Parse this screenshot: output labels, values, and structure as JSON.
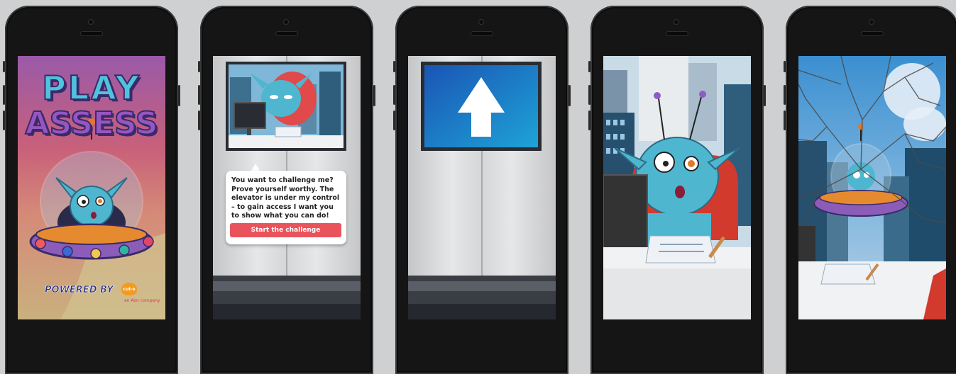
{
  "screens": [
    {
      "id": "title",
      "title_line1": "PLAY",
      "title_line2": "ASSESS",
      "powered_by": "POWERED BY",
      "logo_text": "cut-e",
      "tagline": "an Aon company"
    },
    {
      "id": "challenge",
      "bubble_text": "You want to challenge me? Prove yourself worthy. The elevator is under my control – to gain access I want you to show what you can do!",
      "button_label": "Start the challenge"
    },
    {
      "id": "elevator-up",
      "indicator": "up-arrow-icon"
    },
    {
      "id": "surprised-alien"
    },
    {
      "id": "cracked-screen"
    }
  ],
  "colors": {
    "background": "#cfd0d1",
    "phone_body": "#151515",
    "alien": "#4fb6cf",
    "cta": "#e9535b",
    "screen_blue": "#1e7bc9"
  }
}
